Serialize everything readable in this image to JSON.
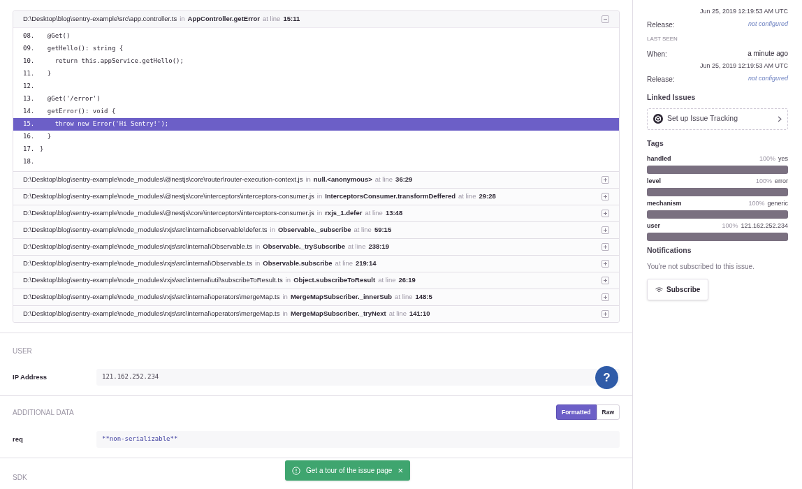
{
  "stacktrace": {
    "frames": [
      {
        "path": "D:\\Desktop\\blog\\sentry-example\\src\\app.controller.ts",
        "in": "in",
        "function": "AppController.getError",
        "at": "at line",
        "line": "15:11",
        "expanded": true,
        "code": [
          {
            "number": "08.",
            "text": "  @Get()",
            "selected": false
          },
          {
            "number": "09.",
            "text": "  getHello(): string {",
            "selected": false
          },
          {
            "number": "10.",
            "text": "    return this.appService.getHello();",
            "selected": false
          },
          {
            "number": "11.",
            "text": "  }",
            "selected": false
          },
          {
            "number": "12.",
            "selected": false
          },
          {
            "number": "13.",
            "text": "  @Get('/error')",
            "selected": false
          },
          {
            "number": "14.",
            "text": "  getError(): void {",
            "selected": false
          },
          {
            "number": "15.",
            "text": "    throw new Error('Hi Sentry!');",
            "selected": true
          },
          {
            "number": "16.",
            "text": "  }",
            "selected": false
          },
          {
            "number": "17.",
            "text": "}",
            "selected": false
          },
          {
            "number": "18.",
            "selected": false
          }
        ]
      },
      {
        "path": "D:\\Desktop\\blog\\sentry-example\\node_modules\\@nestjs\\core\\router\\router-execution-context.js",
        "in": "in",
        "function": "null.<anonymous>",
        "at": "at line",
        "line": "36:29",
        "expanded": false
      },
      {
        "path": "D:\\Desktop\\blog\\sentry-example\\node_modules\\@nestjs\\core\\interceptors\\interceptors-consumer.js",
        "in": "in",
        "function": "InterceptorsConsumer.transformDeffered",
        "at": "at line",
        "line": "29:28",
        "expanded": false
      },
      {
        "path": "D:\\Desktop\\blog\\sentry-example\\node_modules\\@nestjs\\core\\interceptors\\interceptors-consumer.js",
        "in": "in",
        "function": "rxjs_1.defer",
        "at": "at line",
        "line": "13:48",
        "expanded": false
      },
      {
        "path": "D:\\Desktop\\blog\\sentry-example\\node_modules\\rxjs\\src\\internal\\observable\\defer.ts",
        "in": "in",
        "function": "Observable._subscribe",
        "at": "at line",
        "line": "59:15",
        "expanded": false
      },
      {
        "path": "D:\\Desktop\\blog\\sentry-example\\node_modules\\rxjs\\src\\internal\\Observable.ts",
        "in": "in",
        "function": "Observable._trySubscribe",
        "at": "at line",
        "line": "238:19",
        "expanded": false
      },
      {
        "path": "D:\\Desktop\\blog\\sentry-example\\node_modules\\rxjs\\src\\internal\\Observable.ts",
        "in": "in",
        "function": "Observable.subscribe",
        "at": "at line",
        "line": "219:14",
        "expanded": false
      },
      {
        "path": "D:\\Desktop\\blog\\sentry-example\\node_modules\\rxjs\\src\\internal\\util\\subscribeToResult.ts",
        "in": "in",
        "function": "Object.subscribeToResult",
        "at": "at line",
        "line": "26:19",
        "expanded": false
      },
      {
        "path": "D:\\Desktop\\blog\\sentry-example\\node_modules\\rxjs\\src\\internal\\operators\\mergeMap.ts",
        "in": "in",
        "function": "MergeMapSubscriber._innerSub",
        "at": "at line",
        "line": "148:5",
        "expanded": false
      },
      {
        "path": "D:\\Desktop\\blog\\sentry-example\\node_modules\\rxjs\\src\\internal\\operators\\mergeMap.ts",
        "in": "in",
        "function": "MergeMapSubscriber._tryNext",
        "at": "at line",
        "line": "141:10",
        "expanded": false
      }
    ]
  },
  "user": {
    "heading": "USER",
    "rows": [
      {
        "label": "IP Address",
        "value": "121.162.252.234"
      }
    ]
  },
  "additional_data": {
    "heading": "ADDITIONAL DATA",
    "toggle": [
      {
        "label": "Formatted",
        "selected": true
      },
      {
        "label": "Raw",
        "selected": false
      }
    ],
    "rows": [
      {
        "label": "req",
        "value": "**non-serializable**"
      }
    ]
  },
  "sdk": {
    "heading": "SDK"
  },
  "help_button": {
    "label": "?"
  },
  "toast": {
    "text": "Get a tour of the issue page",
    "close": "×"
  },
  "sidebar": {
    "first_seen": {
      "date": "Jun 25, 2019 12:19:53 AM UTC",
      "release_label": "Release:",
      "release": "not configured"
    },
    "last_seen": {
      "heading": "LAST SEEN",
      "when_label": "When:",
      "when": "a minute ago",
      "date": "Jun 25, 2019 12:19:53 AM UTC",
      "release_label": "Release:",
      "release": "not configured"
    },
    "linked_issues": {
      "heading": "Linked Issues",
      "button": "Set up Issue Tracking"
    },
    "tags": {
      "heading": "Tags",
      "items": [
        {
          "name": "handled",
          "percent": "100%",
          "value": "yes",
          "level": 1
        },
        {
          "name": "level",
          "percent": "100%",
          "value": "error",
          "level": 1
        },
        {
          "name": "mechanism",
          "percent": "100%",
          "value": "generic",
          "level": 1
        },
        {
          "name": "user",
          "percent": "100%",
          "value": "121.162.252.234",
          "level": 1
        }
      ]
    },
    "notifications": {
      "heading": "Notifications",
      "text": "You're not subscribed to this issue.",
      "button": "Subscribe"
    }
  }
}
